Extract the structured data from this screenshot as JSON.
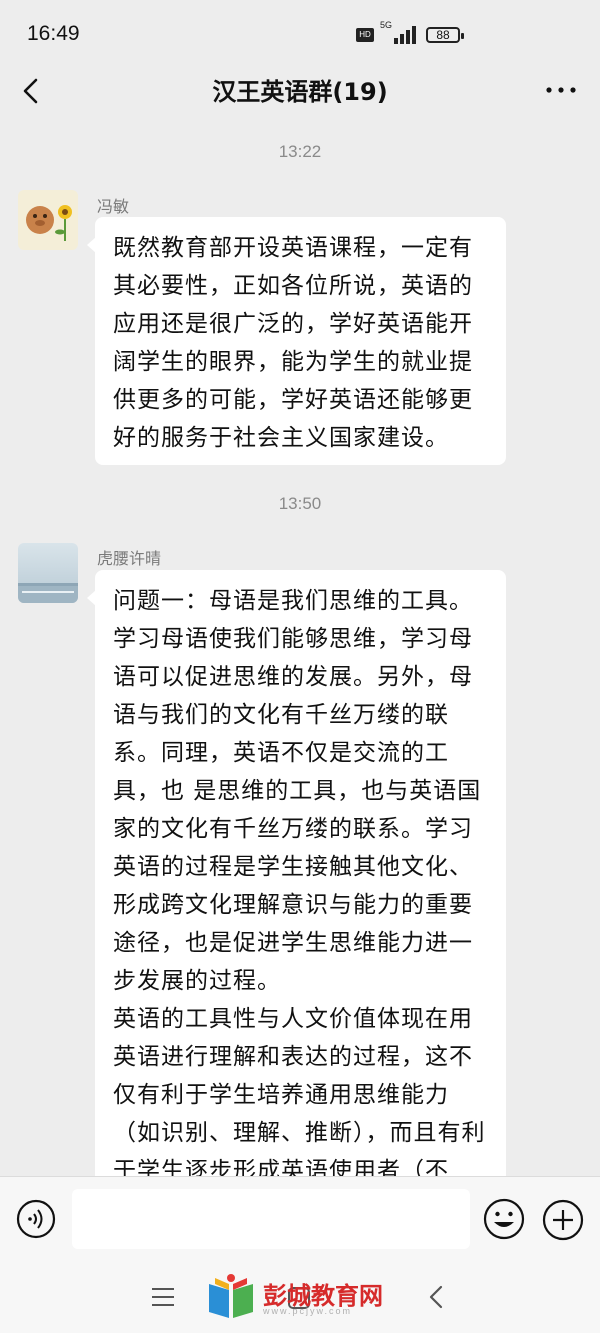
{
  "status": {
    "time": "16:49",
    "hd": "HD",
    "network": "5G",
    "battery": "88"
  },
  "header": {
    "title": "汉王英语群(19)"
  },
  "messages": [
    {
      "time": "13:22",
      "sender": "冯敏",
      "text": "既然教育部开设英语课程，一定有其必要性，正如各位所说，英语的应用还是很广泛的，学好英语能开阔学生的眼界，能为学生的就业提供更多的可能，学好英语还能够更好的服务于社会主义国家建设。"
    },
    {
      "time": "13:50",
      "sender": "虎腰许晴",
      "text": "问题一：母语是我们思维的工具。学习母语使我们能够思维，学习母语可以促进思维的发展。另外，母语与我们的文化有千丝万缕的联系。同理，英语不仅是交流的工具，也 是思维的工具，也与英语国家的文化有千丝万缕的联系。学习英语的过程是学生接触其他文化、 形成跨文化理解意识与能力的重要途径，也是促进学生思维能力进一步发展的过程。\n英语的工具性与人文价值体现在用英语进行理解和表达的过程，这不仅有利于学生培养通用思维能力（如识别、理解、推断），而且有利于学生逐步形成英语使用者（不"
    }
  ],
  "input": {
    "placeholder": ""
  },
  "watermark": {
    "text": "彭城教育网",
    "url": "www.pcjyw.com"
  },
  "colors": {
    "background": "#ededed",
    "bubble": "#ffffff",
    "watermark": "#d62b2b"
  }
}
